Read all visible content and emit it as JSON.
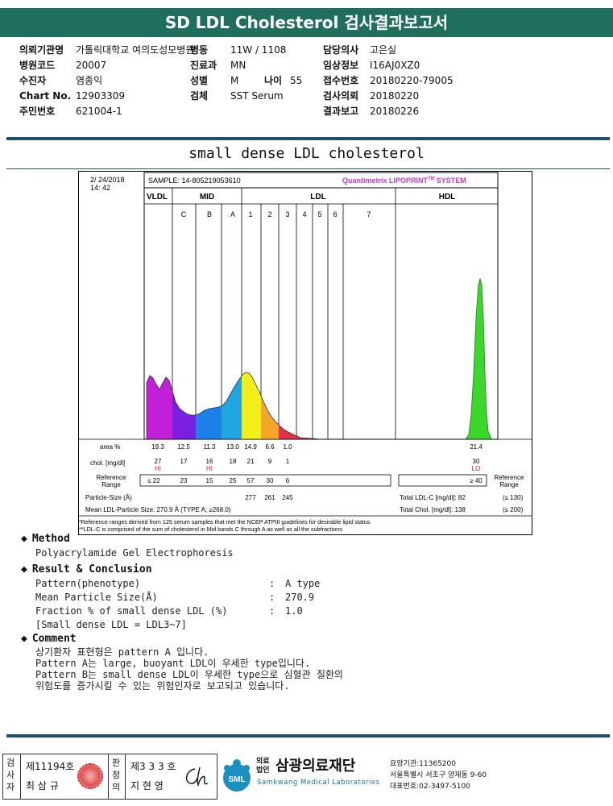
{
  "header": {
    "title": "SD LDL Cholesterol 검사결과보고서"
  },
  "info_left": [
    {
      "label": "의뢰기관명",
      "value": "가톨릭대학교 여의도성모병원"
    },
    {
      "label": "병원코드",
      "value": "20007"
    },
    {
      "label": "수진자",
      "value": "염종익"
    },
    {
      "label": "Chart No.",
      "value": "12903309"
    },
    {
      "label": "주민번호",
      "value": "621004-1"
    }
  ],
  "info_mid": [
    {
      "label": "병동",
      "value": "11W / 1108"
    },
    {
      "label": "진료과",
      "value": "MN"
    },
    {
      "label": "성별",
      "value": "M"
    },
    {
      "label": "검체",
      "value": "SST Serum"
    }
  ],
  "age": {
    "label": "나이",
    "value": "55"
  },
  "info_right": [
    {
      "label": "담당의사",
      "value": "고은실"
    },
    {
      "label": "임상정보",
      "value": "I16AJ0XZ0"
    },
    {
      "label": "접수번호",
      "value": "20180220-79005"
    },
    {
      "label": "검사의뢰",
      "value": "20180220"
    },
    {
      "label": "결과보고",
      "value": "20180226"
    }
  ],
  "section_title": "small dense LDL cholesterol",
  "report": {
    "date": "2/ 24/2018",
    "time": "14: 42",
    "sample": "SAMPLE:  14-805219053610",
    "brand": "Quantimetrix LIPOPRINT",
    "brand_tm": "TM",
    "brand_suffix": "SYSTEM",
    "groups": [
      "VLDL",
      "MID",
      "LDL",
      "HDL"
    ],
    "bands": [
      "C",
      "B",
      "A",
      "1",
      "2",
      "3",
      "4",
      "5",
      "6",
      "7"
    ],
    "area_label": "area %",
    "area_values": [
      "19.3",
      "12.5",
      "11.3",
      "13.0",
      "14.9",
      "6.6",
      "1.0",
      "21.4"
    ],
    "chol_label": "chol. [mg/dl]",
    "chol_values": [
      "27",
      "17",
      "16",
      "18",
      "21",
      "9",
      "1",
      "30"
    ],
    "flags": [
      "HI",
      "HI",
      "LO"
    ],
    "ref_label_1": "Reference",
    "ref_label_2": "Range",
    "ref_values": [
      "≤ 22",
      "23",
      "15",
      "25",
      "57",
      "30",
      "6",
      "≥ 40"
    ],
    "particle_label": "Particle-Size (Å)",
    "particle_values": [
      "277",
      "261",
      "245"
    ],
    "mean_label": "Mean LDL-Particle Size:  270.9 Å  (TYPE A; ≥268.0)",
    "total_ldl": "Total LDL-C [mg/dl]:  82",
    "total_ldl_ref": "(≤ 130)",
    "total_chol": "Total Chol. [mg/dl]:  138",
    "total_chol_ref": "(≤ 200)",
    "footnote_1": "*Reference ranges derived from 125 serum samples that met the NCEP ATPIII guidelines for desirable lipid status",
    "footnote_2": "**LDL-C is comprised of the sum of cholesterol in Mid bands C through A as well as all the subfractions"
  },
  "method": {
    "heading": "Method",
    "text": "Polyacrylamide Gel Electrophoresis"
  },
  "result": {
    "heading": "Result & Conclusion",
    "rows": [
      {
        "label": "Pattern(phenotype)",
        "value": "A type"
      },
      {
        "label": "Mean Particle Size(Å)",
        "value": "270.9"
      },
      {
        "label": "Fraction % of small dense LDL (%)",
        "value": "1.0"
      }
    ],
    "note": "[Small dense LDL = LDL3~7]"
  },
  "comment": {
    "heading": "Comment",
    "lines": [
      "상기환자 표현형은 pattern A 입니다.",
      "Pattern A는 large, buoyant LDL이 우세한 type입니다.",
      "Pattern B는 small dense LDL이 우세한 type으로 심혈관 질환의",
      "위험도를 증가시킬 수 있는 위험인자로 보고되고 있습니다."
    ]
  },
  "footer": {
    "tester_label": "검사자",
    "tester_no": "제11194호",
    "tester_name": "최 삼 규",
    "reviewer_label": "판정의",
    "reviewer_no": "제3 3 3 호",
    "reviewer_name": "지 현 영",
    "org_prefix_1": "의료",
    "org_prefix_2": "법인",
    "org_name": "삼광의료재단",
    "org_en": "Samkwang Medical Laboratories",
    "logo_text": "SML",
    "code": "요양기관:11365200",
    "address": "서울특별시 서초구 양재동 9-60",
    "phone": "대표번호:02-3497-5100"
  }
}
